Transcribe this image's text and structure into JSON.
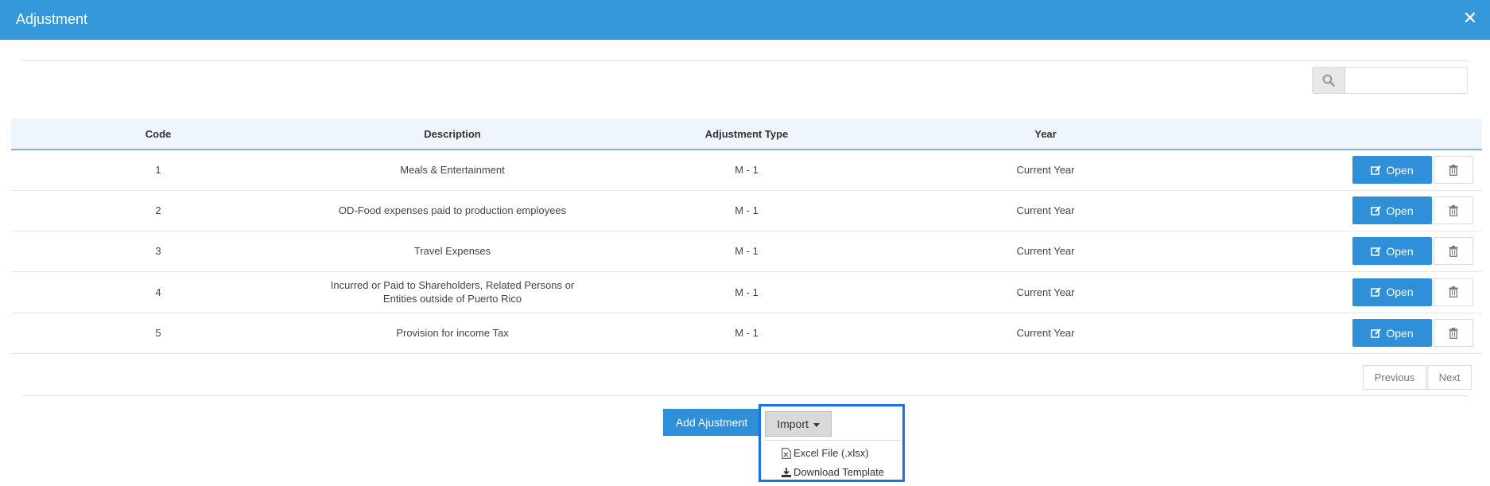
{
  "dialog": {
    "title": "Adjustment",
    "close_glyph": "✕"
  },
  "search": {
    "value": "",
    "placeholder": ""
  },
  "table": {
    "headers": [
      "Code",
      "Description",
      "Adjustment Type",
      "Year"
    ],
    "rows": [
      {
        "code": "1",
        "description": "Meals & Entertainment",
        "type": "M - 1",
        "year": "Current Year"
      },
      {
        "code": "2",
        "description": "OD-Food expenses paid to production employees",
        "type": "M - 1",
        "year": "Current Year"
      },
      {
        "code": "3",
        "description": "Travel Expenses",
        "type": "M - 1",
        "year": "Current Year"
      },
      {
        "code": "4",
        "description_line1": "Incurred or Paid to Shareholders, Related Persons or",
        "description_line2": "Entities outside of Puerto Rico",
        "type": "M - 1",
        "year": "Current Year"
      },
      {
        "code": "5",
        "description": "Provision for income Tax",
        "type": "M - 1",
        "year": "Current Year"
      }
    ],
    "open_label": "Open"
  },
  "pagination": {
    "previous": "Previous",
    "next": "Next"
  },
  "footer": {
    "add_label": "Add Ajustment",
    "import_label": "Import",
    "import_menu": [
      "Excel File (.xlsx)",
      "Download Template"
    ]
  },
  "colors": {
    "primary": "#3498db",
    "button": "#2f8fd8",
    "highlight": "#1a73e8"
  },
  "icons": [
    "close-icon",
    "search-icon",
    "edit-icon",
    "trash-icon",
    "caret-down-icon",
    "excel-file-icon",
    "download-icon"
  ]
}
